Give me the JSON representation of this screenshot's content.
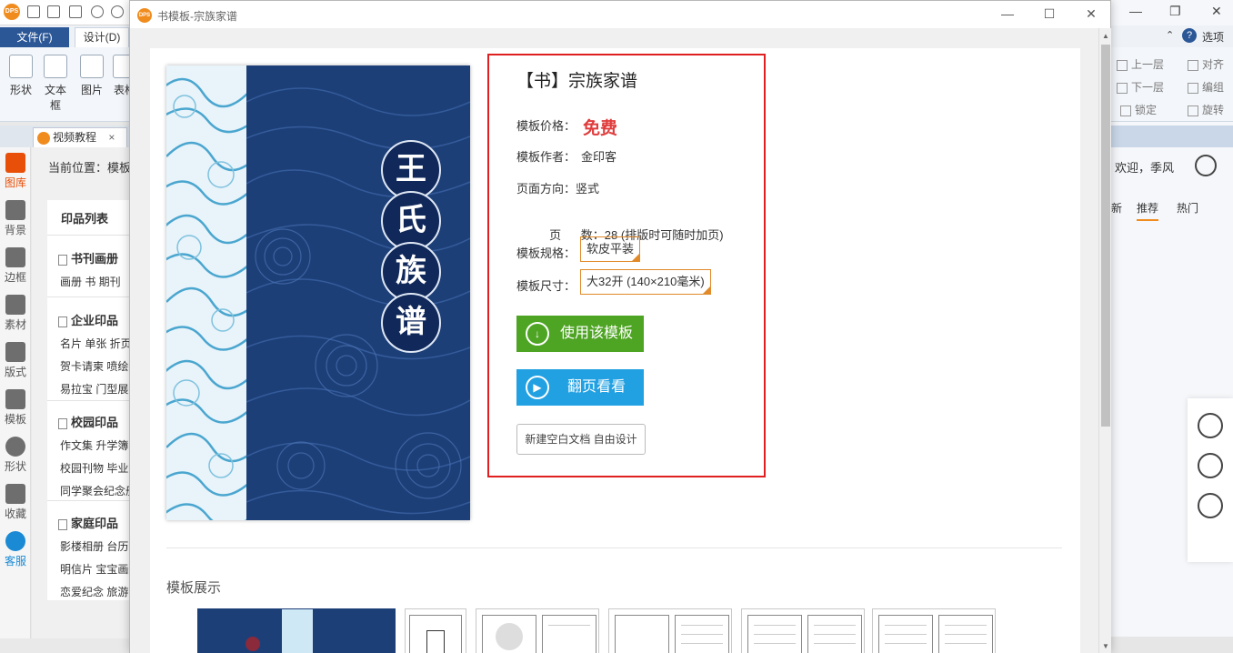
{
  "app": {
    "logo_text": "DPS",
    "menu_tabs": [
      "文件(F)",
      "设计(D)"
    ],
    "ribbon_items": [
      "形状",
      "文本框",
      "图片",
      "表格"
    ],
    "doc_tab": "视频教程",
    "doc_tab_close": "×",
    "breadcrumb": "当前位置：模板",
    "left_nav": [
      "图库",
      "背景",
      "边框",
      "素材",
      "版式",
      "模板",
      "形状",
      "收藏",
      "客服"
    ],
    "print_list": {
      "title": "印品列表",
      "sections": [
        {
          "head": "书刊画册",
          "rows": [
            "画册  书  期刊"
          ]
        },
        {
          "head": "企业印品",
          "rows": [
            "名片  单张  折页",
            "贺卡请柬  喷绘",
            "易拉宝  门型展架"
          ]
        },
        {
          "head": "校园印品",
          "rows": [
            "作文集  升学簿",
            "校园刊物  毕业",
            "同学聚会纪念册"
          ]
        },
        {
          "head": "家庭印品",
          "rows": [
            "影楼相册  台历",
            "明信片  宝宝画册",
            "恋爱纪念  旅游"
          ]
        }
      ]
    },
    "right_panel": {
      "options_label": "选项",
      "ribbon": [
        "上一层",
        "对齐",
        "下一层",
        "编组",
        "锁定",
        "旋转"
      ],
      "welcome": "欢迎，季风",
      "tabs": [
        "新",
        "推荐",
        "热门"
      ]
    }
  },
  "dialog": {
    "title": "书模板-宗族家谱",
    "cover_title_chars": [
      "王",
      "氏",
      "族",
      "谱"
    ],
    "info": {
      "title": "【书】宗族家谱",
      "price_label": "模板价格：",
      "price_value": "免费",
      "author_label": "模板作者：",
      "author_value": "金印客",
      "orientation_label": "页面方向：",
      "orientation_value": "竖式",
      "pages_label": "页      数：",
      "pages_value": "28 (排版时可随时加页)",
      "spec_label": "模板规格：",
      "spec_value": "软皮平装",
      "size_label": "模板尺寸：",
      "size_value": "大32开 (140×210毫米)"
    },
    "buttons": {
      "use": "使用该模板",
      "flip": "翻页看看",
      "new_blank": "新建空白文档 自由设计"
    },
    "showcase_title": "模板展示"
  },
  "colors": {
    "accent_orange": "#f08c1e",
    "file_tab_blue": "#2b5797",
    "highlight_red": "#e02020",
    "use_green": "#4ea423",
    "flip_blue": "#21a0e2",
    "cover_navy": "#1d3f78"
  }
}
